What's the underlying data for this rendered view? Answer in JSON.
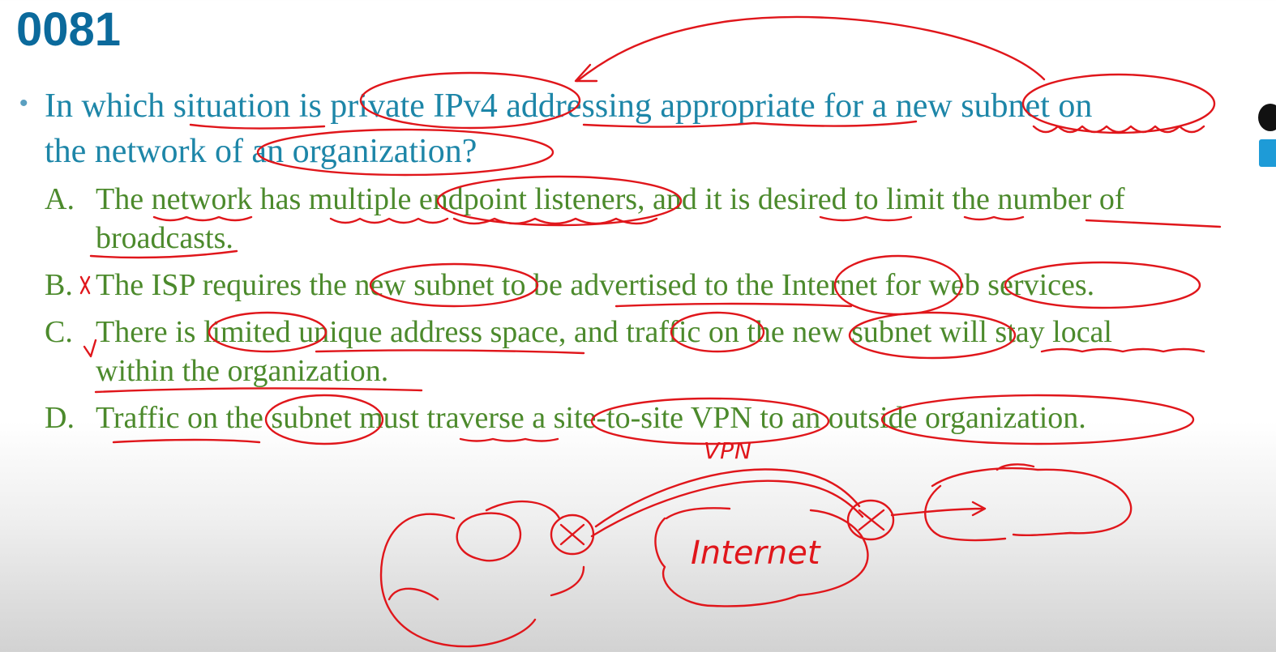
{
  "slide": {
    "number": "0081"
  },
  "question": {
    "text_line1": "In which situation is private IPv4 addressing appropriate for a new subnet on",
    "text_line2": "the network of an organization?"
  },
  "options": [
    {
      "letter": "A.",
      "line1": "The network has multiple endpoint listeners, and it is desired to limit the number of",
      "line2": "broadcasts."
    },
    {
      "letter": "B.",
      "line1": "The ISP requires the new subnet to be advertised to the Internet for web services.",
      "line2": ""
    },
    {
      "letter": "C.",
      "line1": "There is limited unique address space, and traffic on the new subnet will stay local",
      "line2": "within the organization."
    },
    {
      "letter": "D.",
      "line1": "Traffic on the subnet must traverse a site-to-site VPN to an outside organization.",
      "line2": ""
    }
  ],
  "annotations": {
    "vpn": "VPN",
    "internet": "Internet",
    "ink_color": "#e0161b"
  },
  "colors": {
    "slide_number": "#0b6a9c",
    "question": "#1d86a8",
    "options": "#4c8a2c"
  }
}
